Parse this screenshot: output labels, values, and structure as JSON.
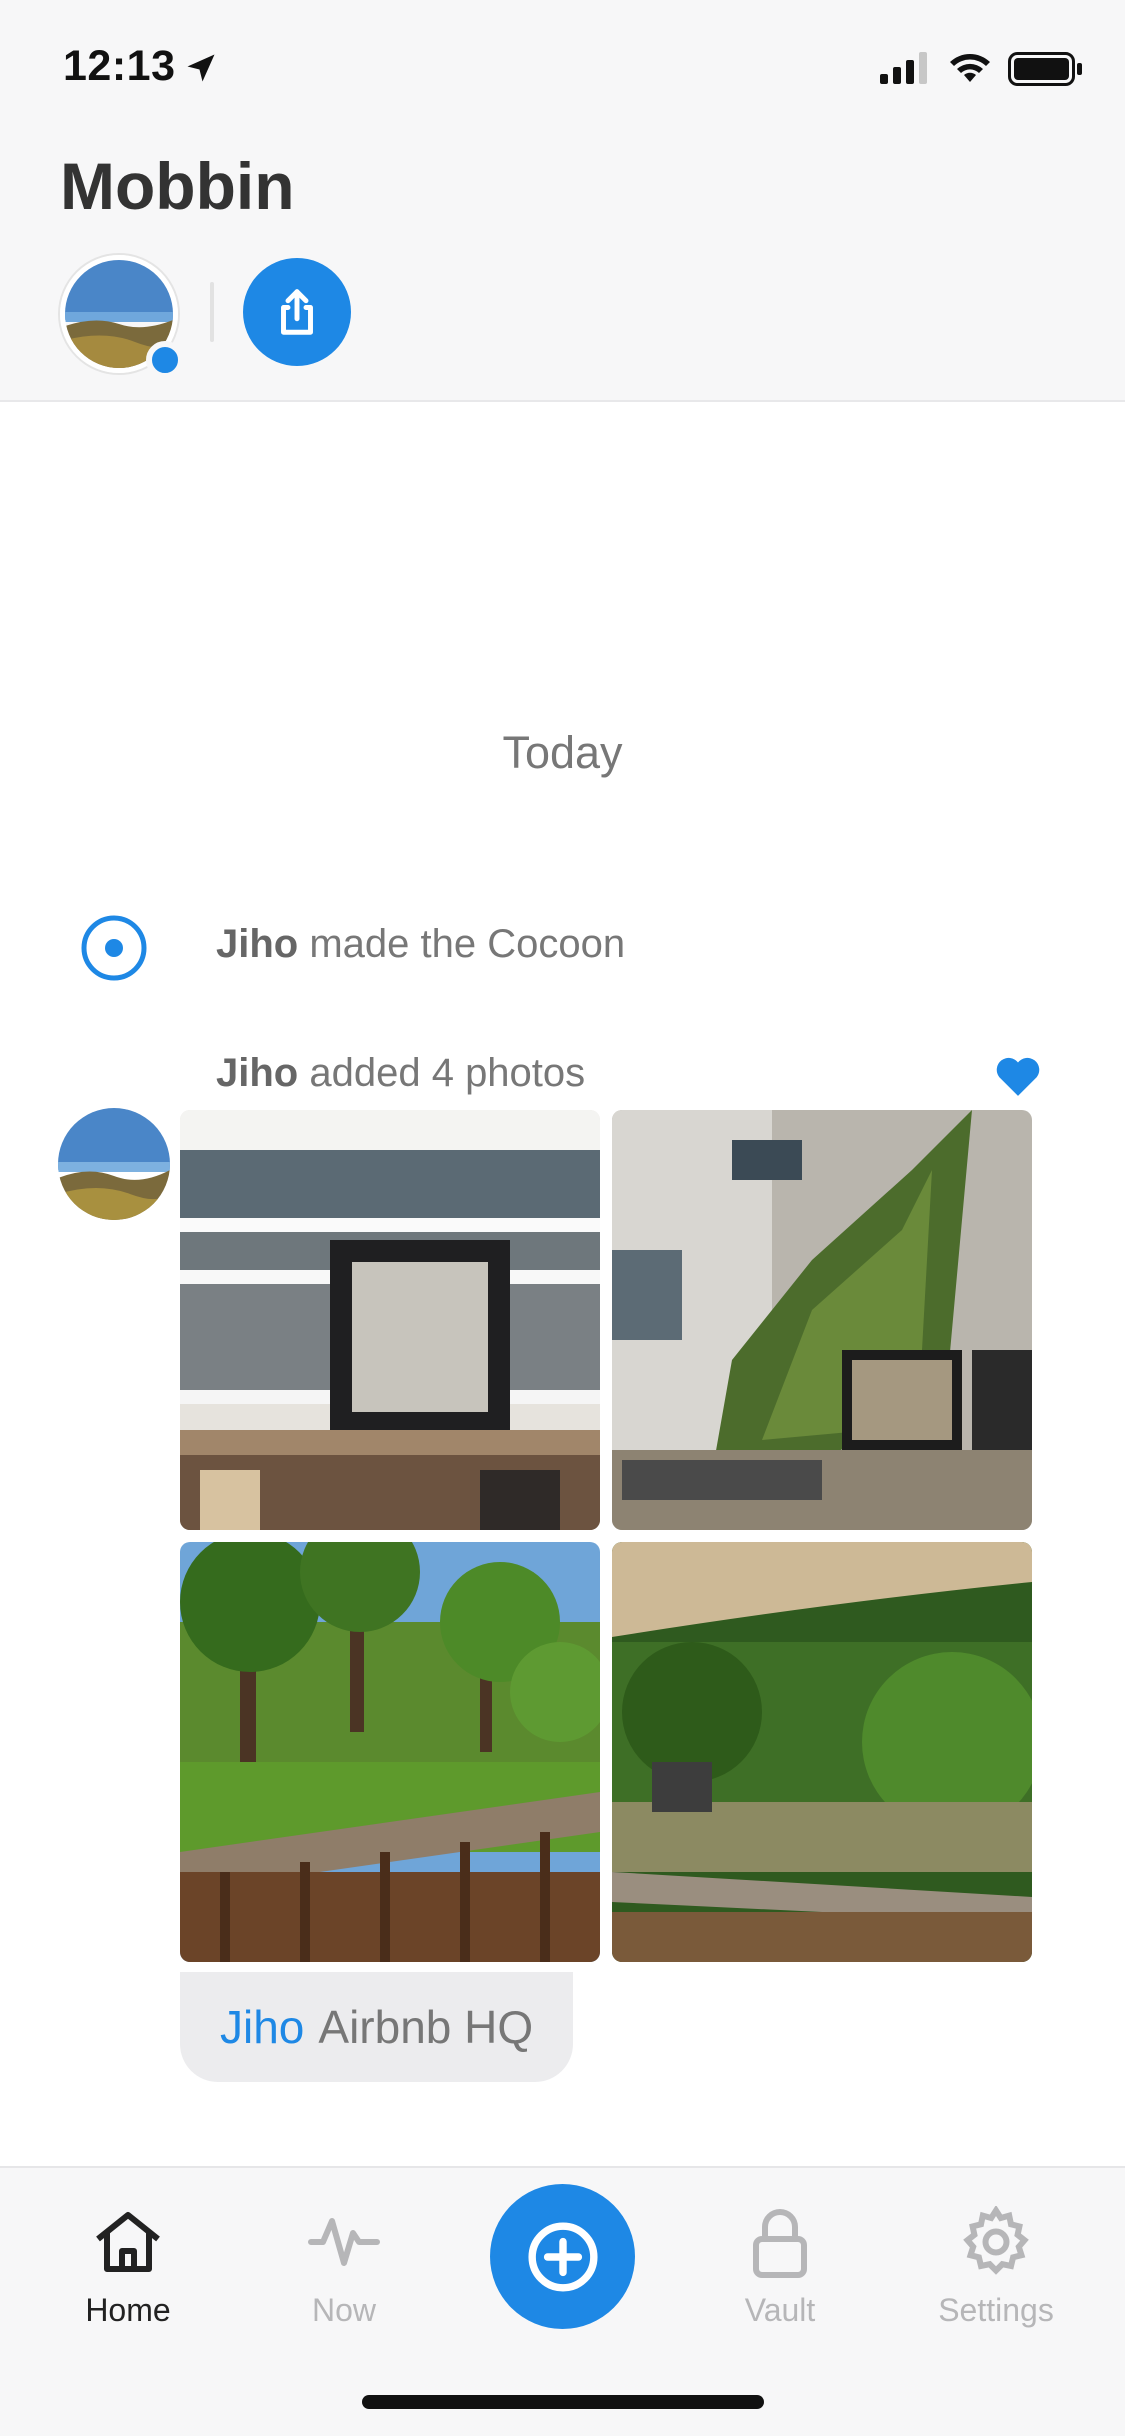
{
  "status": {
    "time": "12:13"
  },
  "header": {
    "title": "Mobbin"
  },
  "feed": {
    "date_label": "Today",
    "event1": {
      "user": "Jiho",
      "text": "made the Cocoon"
    },
    "event2": {
      "user": "Jiho",
      "text": "added 4 photos"
    },
    "caption": {
      "user": "Jiho",
      "place": "Airbnb HQ"
    }
  },
  "tabs": {
    "home": "Home",
    "now": "Now",
    "vault": "Vault",
    "settings": "Settings"
  },
  "colors": {
    "accent": "#1e88e5",
    "muted": "#777777",
    "tab_inactive": "#b6b6b8"
  },
  "icons": {
    "share": "share-icon",
    "heart": "heart-icon",
    "home": "home-icon",
    "now": "activity-icon",
    "add": "plus-circle-icon",
    "vault": "lock-icon",
    "settings": "gear-icon"
  }
}
